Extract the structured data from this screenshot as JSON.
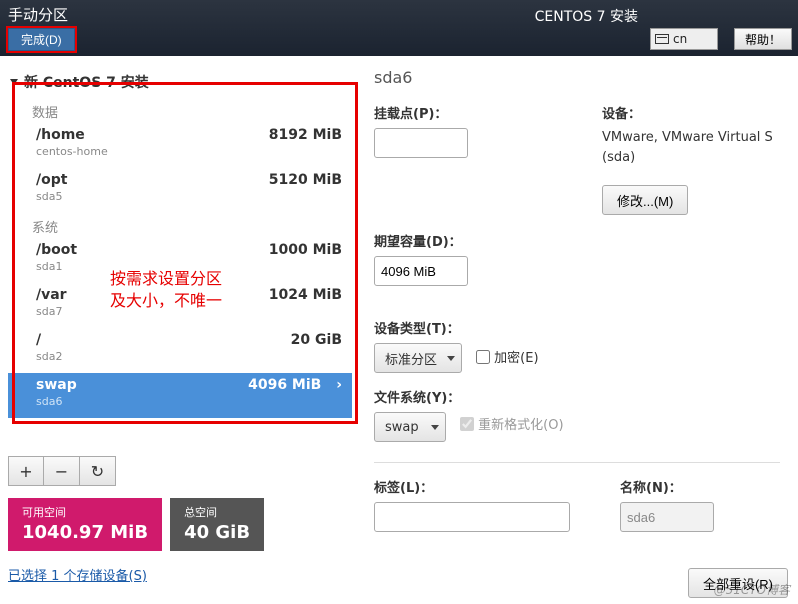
{
  "header": {
    "title_left": "手动分区",
    "done_button": "完成(D)",
    "title_right": "CENTOS 7 安装",
    "keyboard": "cn",
    "help_button": "帮助！"
  },
  "left_panel": {
    "install_title": "新 CentOS 7 安装",
    "section_data": "数据",
    "section_system": "系统",
    "partitions": {
      "home": {
        "mount": "/home",
        "dev": "centos-home",
        "size": "8192 MiB"
      },
      "opt": {
        "mount": "/opt",
        "dev": "sda5",
        "size": "5120 MiB"
      },
      "boot": {
        "mount": "/boot",
        "dev": "sda1",
        "size": "1000 MiB"
      },
      "var": {
        "mount": "/var",
        "dev": "sda7",
        "size": "1024 MiB"
      },
      "root": {
        "mount": "/",
        "dev": "sda2",
        "size": "20 GiB"
      },
      "swap": {
        "mount": "swap",
        "dev": "sda6",
        "size": "4096 MiB"
      }
    },
    "toolbar": {
      "add": "+",
      "remove": "−",
      "reload": "↻"
    },
    "space_free_label": "可用空间",
    "space_free_value": "1040.97 MiB",
    "space_total_label": "总空间",
    "space_total_value": "40 GiB",
    "selected_link": "已选择 1 个存储设备(S)"
  },
  "right_panel": {
    "title": "sda6",
    "mount_label": "挂载点(P)：",
    "mount_value": "",
    "device_label": "设备：",
    "device_text": "VMware, VMware Virtual S (sda)",
    "modify_button": "修改...(M)",
    "capacity_label": "期望容量(D)：",
    "capacity_value": "4096 MiB",
    "devtype_label": "设备类型(T)：",
    "devtype_value": "标准分区",
    "encrypt_label": "加密(E)",
    "fs_label": "文件系统(Y)：",
    "fs_value": "swap",
    "reformat_label": "重新格式化(O)",
    "tag_label": "标签(L)：",
    "tag_value": "",
    "name_label": "名称(N)：",
    "name_value": "sda6",
    "reset_button": "全部重设(R)"
  },
  "annotation": {
    "line1": "按需求设置分区",
    "line2": "及大小，不唯一"
  },
  "watermark": "@51CTO博客"
}
